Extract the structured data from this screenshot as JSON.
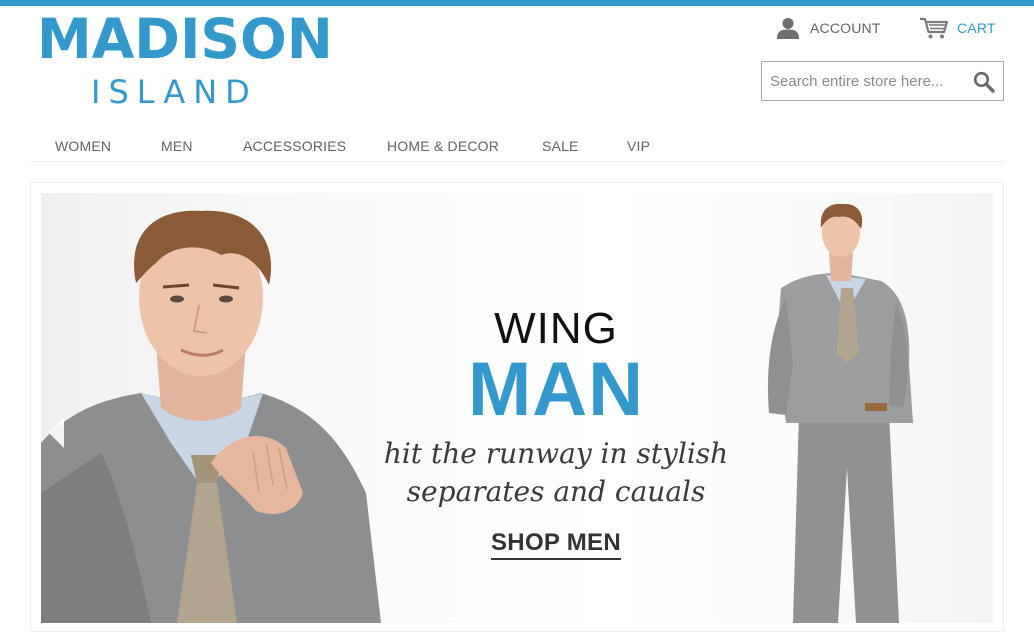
{
  "header": {
    "logo_main": "MADISON",
    "logo_sub": "ISLAND",
    "account_label": "ACCOUNT",
    "cart_label": "CART",
    "search_placeholder": "Search entire store here...",
    "search_value": ""
  },
  "nav": {
    "items": [
      "WOMEN",
      "MEN",
      "ACCESSORIES",
      "HOME & DECOR",
      "SALE",
      "VIP"
    ]
  },
  "hero": {
    "line1": "WING",
    "line2": "MAN",
    "line3a": "hit the runway in stylish",
    "line3b": "separates and cauals",
    "cta": "SHOP MEN"
  },
  "colors": {
    "accent": "#3399cc",
    "text": "#636363",
    "border": "#a8a8a8"
  },
  "icons": [
    "account-icon",
    "cart-icon",
    "search-icon",
    "prev-slide-arrow-icon"
  ]
}
